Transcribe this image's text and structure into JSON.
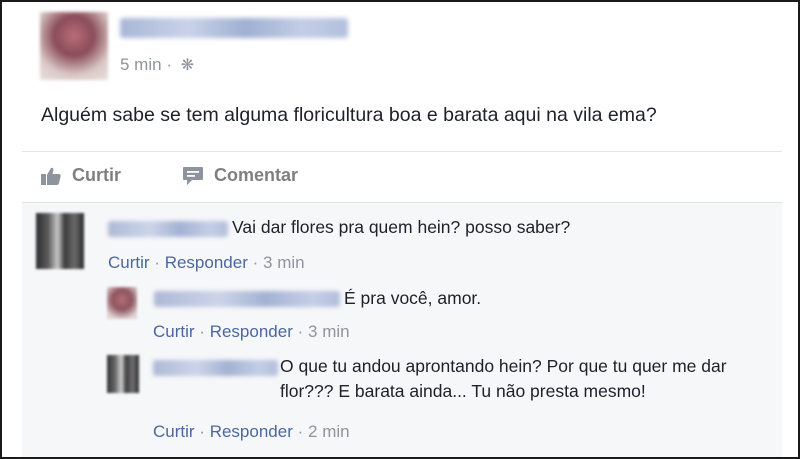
{
  "post": {
    "time": "5 min",
    "dot": "·",
    "text": "Alguém sabe se tem alguma floricultura boa e barata aqui na vila ema?",
    "actions": {
      "like": "Curtir",
      "comment": "Comentar"
    }
  },
  "comments": [
    {
      "text": "Vai dar flores pra quem hein? posso saber?",
      "like": "Curtir",
      "sep1": "·",
      "reply": "Responder",
      "sep2": "·",
      "time": "3 min"
    },
    {
      "text": "É pra você, amor.",
      "like": "Curtir",
      "sep1": "·",
      "reply": "Responder",
      "sep2": "·",
      "time": "3 min"
    },
    {
      "text": "O que tu andou aprontando hein? Por que tu quer me dar flor??? E barata ainda... Tu não presta mesmo!",
      "like": "Curtir",
      "sep1": "·",
      "reply": "Responder",
      "sep2": "·",
      "time": "2 min"
    }
  ],
  "icons": {
    "privacy": "gear-icon",
    "like": "thumbs-up-icon",
    "comment": "speech-bubble-icon"
  },
  "colors": {
    "link": "#4b67a1",
    "meta": "#90949c",
    "text": "#1d2129",
    "comments_bg": "#f6f7f9"
  }
}
